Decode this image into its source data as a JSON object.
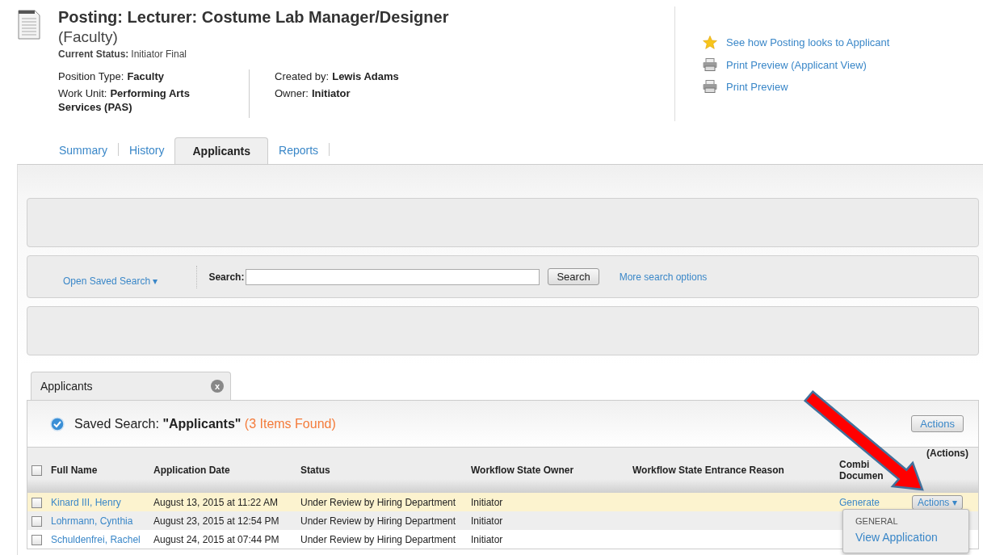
{
  "posting": {
    "title": "Posting: Lecturer: Costume Lab Manager/Designer",
    "subtitle": "(Faculty)",
    "status_label": "Current Status:",
    "status_value": "Initiator Final",
    "details_left": [
      {
        "label": "Position Type:",
        "value": "Faculty"
      },
      {
        "label": "Work Unit:",
        "value": "Performing Arts Services (PAS)"
      }
    ],
    "details_right": [
      {
        "label": "Created by:",
        "value": "Lewis Adams"
      },
      {
        "label": "Owner:",
        "value": "Initiator"
      }
    ]
  },
  "links": [
    {
      "kind": "star",
      "label": "See how Posting looks to Applicant"
    },
    {
      "kind": "printer",
      "label": "Print Preview (Applicant View)"
    },
    {
      "kind": "printer",
      "label": "Print Preview"
    }
  ],
  "tabs": [
    {
      "label": "Summary",
      "selected": false
    },
    {
      "label": "History",
      "selected": false
    },
    {
      "label": "Applicants",
      "selected": true
    },
    {
      "label": "Reports",
      "selected": false
    }
  ],
  "search": {
    "saved_search": "Open Saved Search ▾",
    "label": "Search:",
    "button": "Search",
    "more": "More search options"
  },
  "results_tab": {
    "label": "Applicants",
    "close": "x"
  },
  "saved_search": {
    "label": "Saved Search:",
    "name": "\"Applicants\"",
    "count": "(3 Items Found)",
    "actions": "Actions"
  },
  "table": {
    "select_all_checked": false,
    "columns": [
      "Full Name",
      "Application Date",
      "Status",
      "Workflow State Owner",
      "Workflow State Entrance Reason",
      "Combi Documen",
      "(Actions)"
    ],
    "rows": [
      {
        "checked": false,
        "selected": true,
        "name": "Kinard III, Henry",
        "date": "August 13, 2015 at 11:22 AM",
        "status": "Under Review by Hiring Department",
        "owner": "Initiator",
        "combined": "Generate",
        "actions": "Actions ▾"
      },
      {
        "checked": false,
        "selected": false,
        "name": "Lohrmann, Cynthia",
        "date": "August 23, 2015 at 12:54 PM",
        "status": "Under Review by Hiring Department",
        "owner": "Initiator"
      },
      {
        "checked": false,
        "selected": false,
        "name": "Schuldenfrei, Rachel",
        "date": "August 24, 2015 at 07:44 PM",
        "status": "Under Review by Hiring Department",
        "owner": "Initiator"
      }
    ]
  },
  "menu": {
    "heading": "GENERAL",
    "items": [
      "View Application"
    ]
  }
}
